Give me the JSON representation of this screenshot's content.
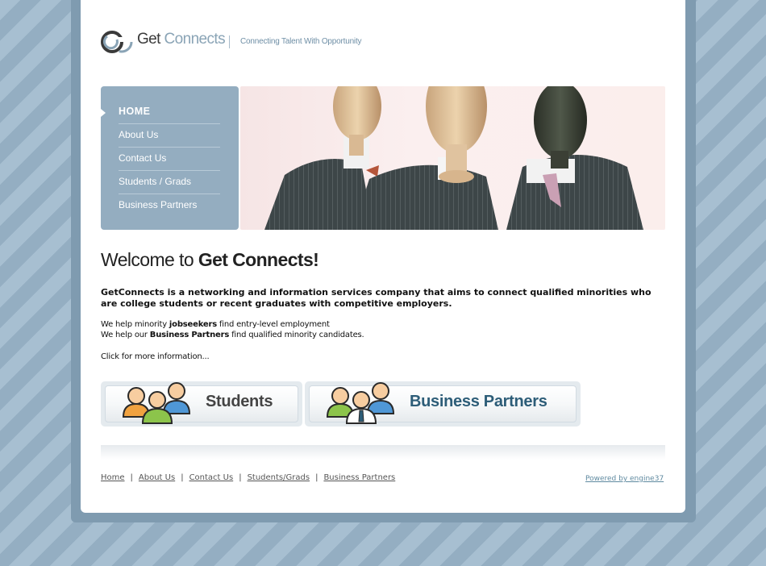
{
  "header": {
    "logo_part1": "Get",
    "logo_part2": "Connects",
    "tagline": "Connecting Talent With Opportunity"
  },
  "nav": {
    "items": [
      {
        "label": "HOME"
      },
      {
        "label": "About Us"
      },
      {
        "label": "Contact Us"
      },
      {
        "label": "Students / Grads"
      },
      {
        "label": "Business Partners"
      }
    ]
  },
  "main": {
    "welcome_prefix": "Welcome to ",
    "welcome_brand": "Get Connects!",
    "intro": "GetConnects is a networking and information services company that aims to connect qualified minorities who are college students or recent graduates with competitive employers.",
    "help1_pre": "We help minority ",
    "help1_bold": "jobseekers",
    "help1_post": " find entry-level employment",
    "help2_pre": "We help our ",
    "help2_bold": "Business Partners",
    "help2_post": " find qualified minority candidates.",
    "click_more": "Click for more information...",
    "students_button": "Students",
    "partners_button": "Business Partners"
  },
  "footer": {
    "links": [
      "Home",
      "About Us",
      "Contact Us",
      "Students/Grads",
      "Business Partners"
    ],
    "separator": "|",
    "powered_by": "Powered by engine37"
  },
  "colors": {
    "nav_bg": "#94adc0",
    "students_label": "#444444",
    "partners_label": "#2d5d78"
  },
  "icons": {
    "logo": "g-circle-logo-icon",
    "hero": "wooden-mannequins-in-suits-image",
    "students": "people-group-icon",
    "partners": "business-people-group-icon"
  }
}
